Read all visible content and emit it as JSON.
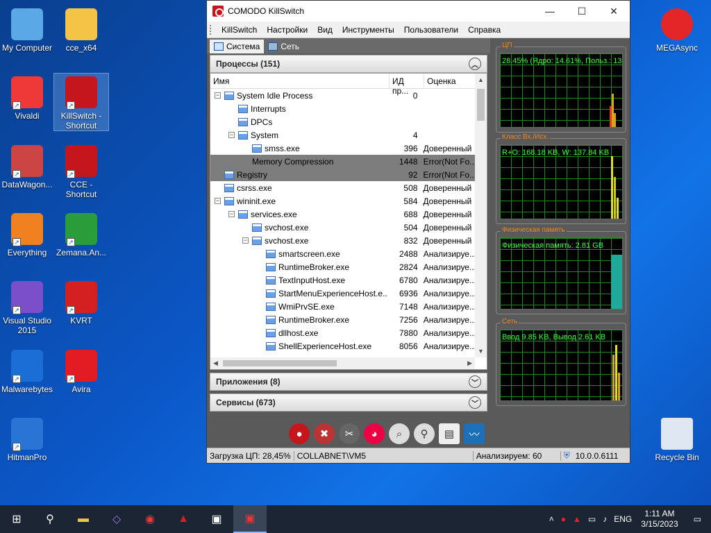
{
  "desktop": {
    "icons_left": [
      {
        "label": "My Computer",
        "icon": "computer-icon"
      },
      {
        "label": "cce_x64",
        "icon": "folder-icon"
      },
      {
        "label": "Vivaldi",
        "icon": "vivaldi-icon"
      },
      {
        "label": "KillSwitch - Shortcut",
        "icon": "killswitch-icon"
      },
      {
        "label": "DataWagon...",
        "icon": "datawagon-icon"
      },
      {
        "label": "CCE - Shortcut",
        "icon": "cce-icon"
      },
      {
        "label": "Everything",
        "icon": "search-icon"
      },
      {
        "label": "Zemana.An...",
        "icon": "zemana-icon"
      },
      {
        "label": "Visual Studio 2015",
        "icon": "visual-studio-icon"
      },
      {
        "label": "KVRT",
        "icon": "kvrt-icon"
      },
      {
        "label": "Malwarebytes",
        "icon": "malwarebytes-icon"
      },
      {
        "label": "Avira",
        "icon": "avira-icon"
      },
      {
        "label": "HitmanPro",
        "icon": "hitmanpro-icon"
      }
    ],
    "icons_right": [
      {
        "label": "MEGAsync",
        "icon": "mega-icon"
      },
      {
        "label": "Recycle Bin",
        "icon": "recycle-bin-icon"
      }
    ]
  },
  "window": {
    "title": "COMODO KillSwitch",
    "menu": [
      "KillSwitch",
      "Настройки",
      "Вид",
      "Инструменты",
      "Пользователи",
      "Справка"
    ],
    "tabs": [
      "Система",
      "Сеть"
    ],
    "processes_header": "Процессы (151)",
    "columns": [
      "Имя",
      "ИД пр...",
      "Оценка"
    ],
    "processes": [
      {
        "name": "System Idle Process",
        "pid": "0",
        "rating": "",
        "indent": 0,
        "exp": "−",
        "icon": true
      },
      {
        "name": "Interrupts",
        "pid": "",
        "rating": "",
        "indent": 1,
        "exp": "",
        "icon": true
      },
      {
        "name": "DPCs",
        "pid": "",
        "rating": "",
        "indent": 1,
        "exp": "",
        "icon": true
      },
      {
        "name": "System",
        "pid": "4",
        "rating": "",
        "indent": 1,
        "exp": "−",
        "icon": true
      },
      {
        "name": "smss.exe",
        "pid": "396",
        "rating": "Доверенный",
        "indent": 2,
        "exp": "",
        "icon": true
      },
      {
        "name": "Memory Compression",
        "pid": "1448",
        "rating": "Error(Not Fo...",
        "indent": 2,
        "exp": "",
        "icon": false,
        "sel": true
      },
      {
        "name": "Registry",
        "pid": "92",
        "rating": "Error(Not Fo...",
        "indent": 0,
        "exp": "",
        "icon": true,
        "sel": true
      },
      {
        "name": "csrss.exe",
        "pid": "508",
        "rating": "Доверенный",
        "indent": 0,
        "exp": "",
        "icon": true
      },
      {
        "name": "wininit.exe",
        "pid": "584",
        "rating": "Доверенный",
        "indent": 0,
        "exp": "−",
        "icon": true
      },
      {
        "name": "services.exe",
        "pid": "688",
        "rating": "Доверенный",
        "indent": 1,
        "exp": "−",
        "icon": true
      },
      {
        "name": "svchost.exe",
        "pid": "504",
        "rating": "Доверенный",
        "indent": 2,
        "exp": "",
        "icon": true
      },
      {
        "name": "svchost.exe",
        "pid": "832",
        "rating": "Доверенный",
        "indent": 2,
        "exp": "−",
        "icon": true
      },
      {
        "name": "smartscreen.exe",
        "pid": "2488",
        "rating": "Анализируе...",
        "indent": 3,
        "exp": "",
        "icon": true
      },
      {
        "name": "RuntimeBroker.exe",
        "pid": "2824",
        "rating": "Анализируе...",
        "indent": 3,
        "exp": "",
        "icon": true
      },
      {
        "name": "TextInputHost.exe",
        "pid": "6780",
        "rating": "Анализируе...",
        "indent": 3,
        "exp": "",
        "icon": true
      },
      {
        "name": "StartMenuExperienceHost.e...",
        "pid": "6936",
        "rating": "Анализируе...",
        "indent": 3,
        "exp": "",
        "icon": true
      },
      {
        "name": "WmiPrvSE.exe",
        "pid": "7148",
        "rating": "Анализируе...",
        "indent": 3,
        "exp": "",
        "icon": true
      },
      {
        "name": "RuntimeBroker.exe",
        "pid": "7256",
        "rating": "Анализируе...",
        "indent": 3,
        "exp": "",
        "icon": true
      },
      {
        "name": "dllhost.exe",
        "pid": "7880",
        "rating": "Анализируе...",
        "indent": 3,
        "exp": "",
        "icon": true
      },
      {
        "name": "ShellExperienceHost.exe",
        "pid": "8056",
        "rating": "Анализируе...",
        "indent": 3,
        "exp": "",
        "icon": true
      }
    ],
    "apps_header": "Приложения (8)",
    "services_header": "Сервисы (673)",
    "graphs": [
      {
        "label": "ЦП",
        "text": "28.45% (Ядро: 14.61%, Польз.: 13"
      },
      {
        "label": "Класс Вх./Исх.",
        "text": "R+O: 168.18 KB, W: 137.84 KB"
      },
      {
        "label": "Физическая память",
        "text": "Физическая память: 2.81 GB"
      },
      {
        "label": "Сеть",
        "text": "Ввод 9.85 KB, Вывод 2.61 KB"
      }
    ],
    "status": {
      "cpu": "Загрузка ЦП: 28,45%",
      "user": "COLLABNET\\VM5",
      "analyzing": "Анализируем: 60",
      "version": "10.0.0.6111"
    }
  },
  "taskbar": {
    "lang": "ENG",
    "time": "1:11 AM",
    "date": "3/15/2023"
  }
}
